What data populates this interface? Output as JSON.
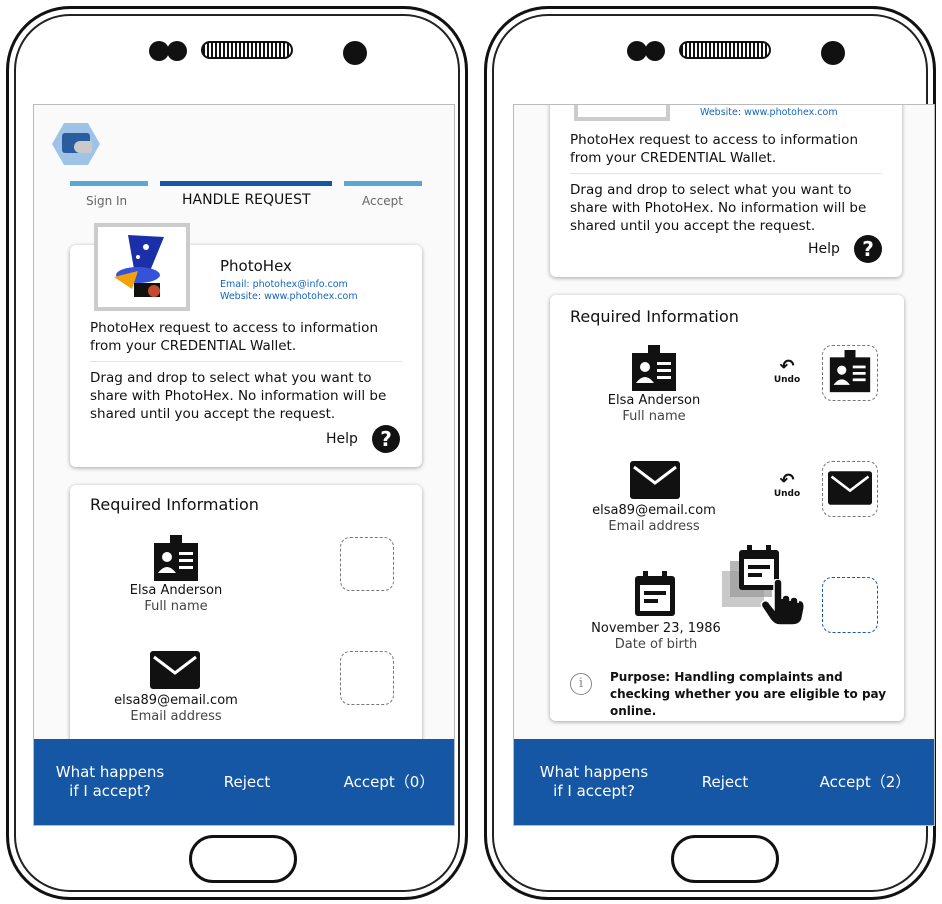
{
  "left": {
    "steps": [
      "Sign In",
      "HANDLE REQUEST",
      "Accept"
    ],
    "requester": {
      "name": "PhotoHex",
      "email": "Email: photohex@info.com",
      "website": "Website: www.photohex.com",
      "request_text": "PhotoHex request to access to information from your CREDENTIAL Wallet.",
      "instructions": "Drag and drop to select what you want to share with PhotoHex. No information will be shared until you accept the request.",
      "help_label": "Help"
    },
    "required": {
      "title": "Required Information",
      "items": [
        {
          "value": "Elsa Anderson",
          "label": "Full name",
          "icon": "id-card-icon"
        },
        {
          "value": "elsa89@email.com",
          "label": "Email address",
          "icon": "envelope-icon"
        }
      ]
    },
    "footer": {
      "what_happens": "What happens if I accept?",
      "reject": "Reject",
      "accept": "Accept（0）"
    }
  },
  "right": {
    "requester": {
      "website_partial": "Website: www.photohex.com",
      "request_text": "PhotoHex request to access to information from your CREDENTIAL Wallet.",
      "instructions": "Drag and drop to select what you want to share with PhotoHex. No information will be shared until you accept the request.",
      "help_label": "Help"
    },
    "required": {
      "title": "Required Information",
      "items": [
        {
          "value": "Elsa Anderson",
          "label": "Full name",
          "icon": "id-card-icon",
          "undo": "Undo"
        },
        {
          "value": "elsa89@email.com",
          "label": "Email address",
          "icon": "envelope-icon",
          "undo": "Undo"
        },
        {
          "value": "November 23, 1986",
          "label": "Date of birth",
          "icon": "calendar-icon"
        }
      ],
      "purpose": "Purpose: Handling complaints and checking whether you are eligible to pay online."
    },
    "footer": {
      "what_happens": "What happens if I accept?",
      "reject": "Reject",
      "accept": "Accept（2）"
    }
  },
  "colors": {
    "footer_blue": "#1557a5",
    "step_active": "#1557a5",
    "step_inactive": "#5aa7d6",
    "link_blue": "#1565c0"
  }
}
